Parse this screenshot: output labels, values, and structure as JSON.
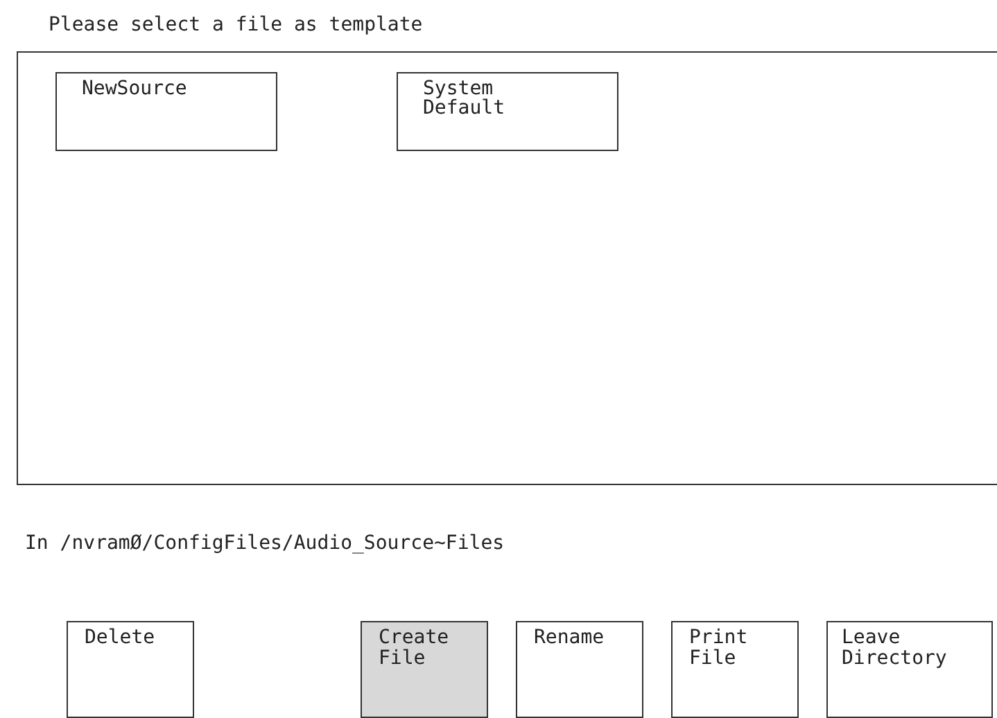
{
  "prompt": "Please select a file as template",
  "files": [
    {
      "label": "NewSource",
      "selected": false
    },
    {
      "label": "System\nDefault",
      "selected": false
    }
  ],
  "directory": "In /nvramØ/ConfigFiles/Audio_Source~Files",
  "buttons": [
    {
      "label": "Delete",
      "selected": false
    },
    {
      "label": "Create\nFile",
      "selected": true
    },
    {
      "label": "Rename",
      "selected": false
    },
    {
      "label": "Print\nFile",
      "selected": false
    },
    {
      "label": "Leave\nDirectory",
      "selected": false
    }
  ]
}
